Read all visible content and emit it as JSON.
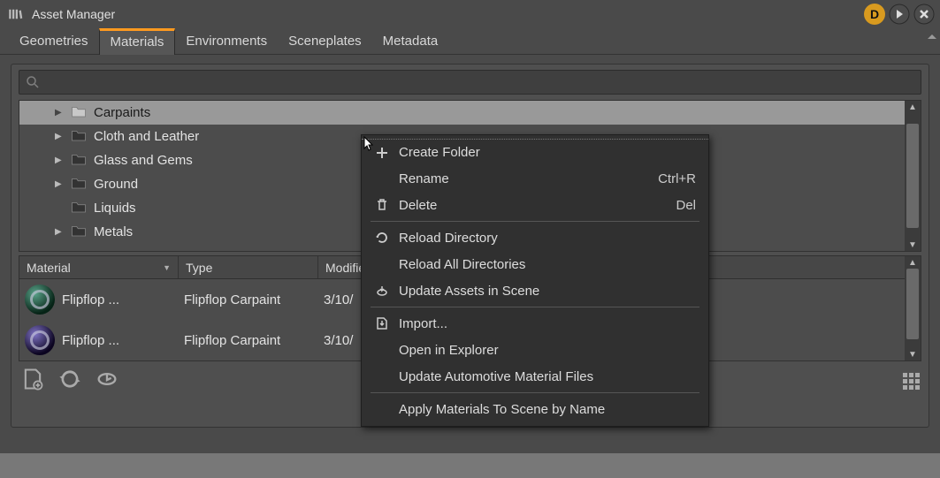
{
  "title": "Asset Manager",
  "titlebar": {
    "badge_letter": "D"
  },
  "tabs": [
    {
      "label": "Geometries",
      "active": false
    },
    {
      "label": "Materials",
      "active": true
    },
    {
      "label": "Environments",
      "active": false
    },
    {
      "label": "Sceneplates",
      "active": false
    },
    {
      "label": "Metadata",
      "active": false
    }
  ],
  "search": {
    "placeholder": ""
  },
  "tree": {
    "items": [
      {
        "label": "Carpaints",
        "selected": true,
        "expandable": true,
        "folder_style": "light"
      },
      {
        "label": "Cloth and Leather",
        "selected": false,
        "expandable": true,
        "folder_style": "dark"
      },
      {
        "label": "Glass and Gems",
        "selected": false,
        "expandable": true,
        "folder_style": "dark"
      },
      {
        "label": "Ground",
        "selected": false,
        "expandable": true,
        "folder_style": "dark"
      },
      {
        "label": "Liquids",
        "selected": false,
        "expandable": false,
        "folder_style": "dark"
      },
      {
        "label": "Metals",
        "selected": false,
        "expandable": true,
        "folder_style": "dark"
      }
    ]
  },
  "list": {
    "columns": [
      {
        "label": "Material",
        "sort": "desc"
      },
      {
        "label": "Type"
      },
      {
        "label": "Modified"
      }
    ],
    "rows": [
      {
        "name": "Flipflop ...",
        "type": "Flipflop Carpaint",
        "modified": "3/10/",
        "sphere": "a"
      },
      {
        "name": "Flipflop ...",
        "type": "Flipflop Carpaint",
        "modified": "3/10/",
        "sphere": "b"
      }
    ]
  },
  "context_menu": {
    "items": [
      {
        "label": "Create Folder",
        "icon": "plus",
        "accel": ""
      },
      {
        "label": "Rename",
        "icon": "",
        "accel": "Ctrl+R"
      },
      {
        "label": "Delete",
        "icon": "trash",
        "accel": "Del"
      },
      {
        "sep": true
      },
      {
        "label": "Reload Directory",
        "icon": "reload",
        "accel": ""
      },
      {
        "label": "Reload All Directories",
        "icon": "",
        "accel": ""
      },
      {
        "label": "Update Assets in Scene",
        "icon": "update",
        "accel": ""
      },
      {
        "sep": true
      },
      {
        "label": "Import...",
        "icon": "import",
        "accel": ""
      },
      {
        "label": "Open in Explorer",
        "icon": "",
        "accel": ""
      },
      {
        "label": "Update Automotive Material Files",
        "icon": "",
        "accel": ""
      },
      {
        "sep": true
      },
      {
        "label": "Apply Materials To Scene by Name",
        "icon": "",
        "accel": ""
      }
    ]
  }
}
